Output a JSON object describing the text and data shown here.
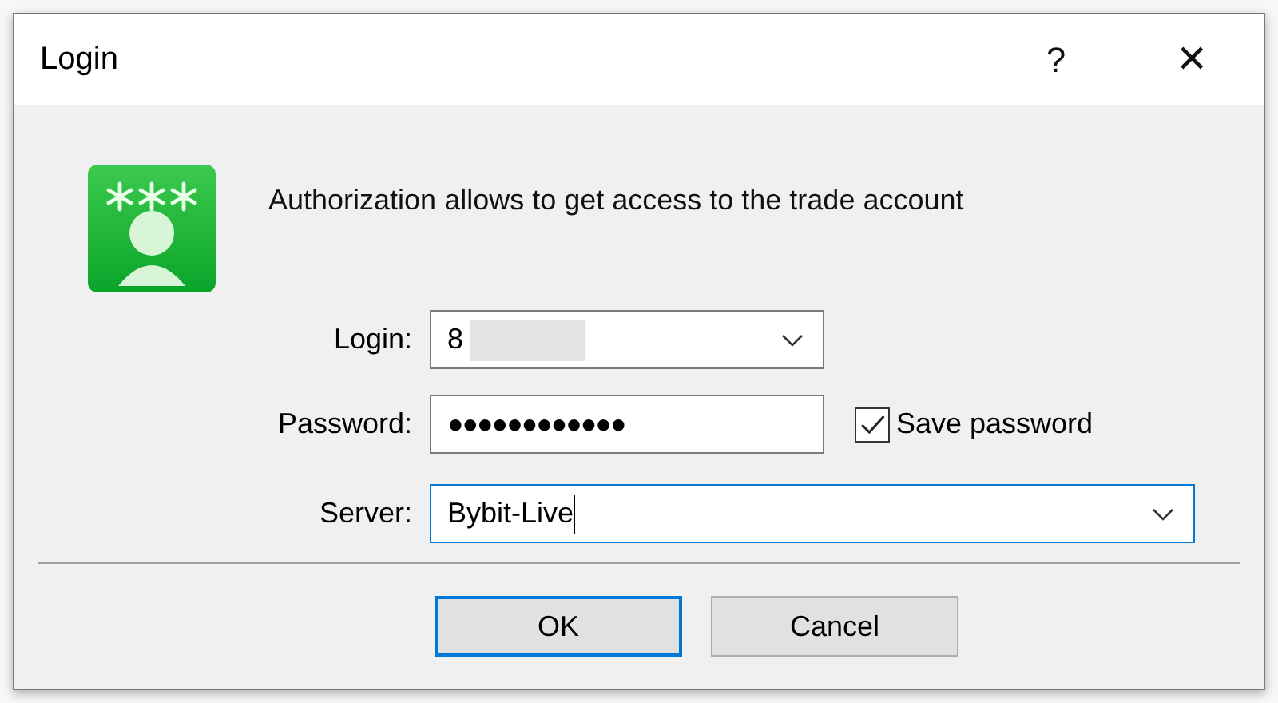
{
  "window": {
    "title": "Login",
    "help": "?",
    "close": "✕"
  },
  "message": "Authorization allows to get access to the trade account",
  "fields": [
    {
      "kind": "combo",
      "label": "Login:",
      "value": "8",
      "redacted": true,
      "focused": false
    },
    {
      "kind": "password",
      "label": "Password:",
      "value": "●●●●●●●●●●●●",
      "focused": false
    },
    {
      "kind": "combo",
      "label": "Server:",
      "value": "Bybit-Live",
      "focused": true
    }
  ],
  "save_password": {
    "label": "Save password",
    "checked": true
  },
  "buttons": [
    {
      "label": "OK",
      "default": true
    },
    {
      "label": "Cancel",
      "default": false
    }
  ]
}
